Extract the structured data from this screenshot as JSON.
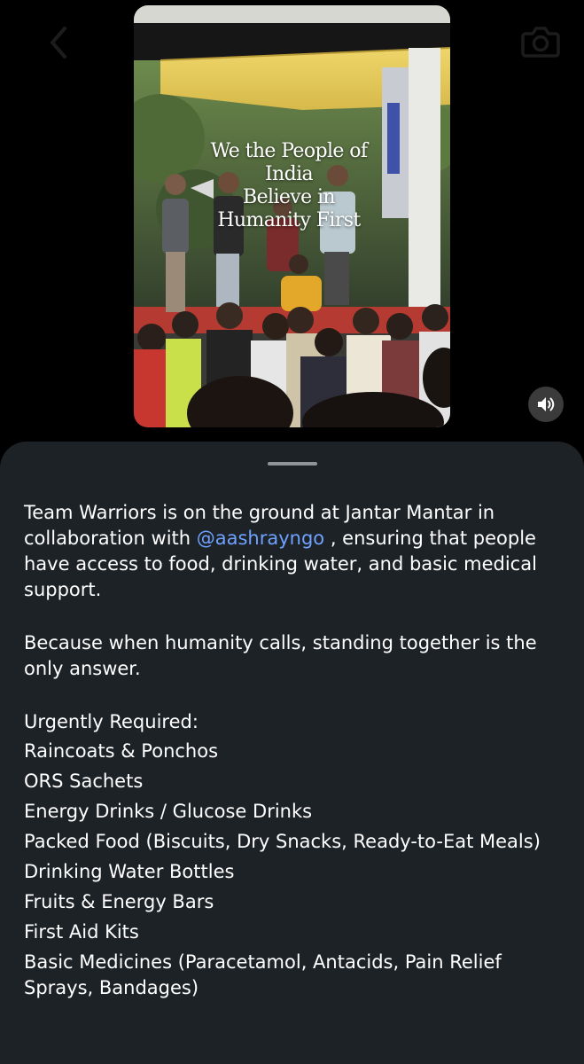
{
  "video": {
    "overlay_text": "We the People of India\nBelieve in\nHumanity First"
  },
  "controls": {
    "back_icon": "chevron-left-icon",
    "camera_icon": "camera-icon",
    "volume_icon": "speaker-on-icon"
  },
  "post": {
    "para1_before": "Team Warriors is on the ground at Jantar Mantar in collaboration with ",
    "mention": "@aashrayngo",
    "para1_after": " , ensuring that people have access to food, drinking water, and basic medical support.",
    "para2": "Because when humanity calls, standing together is the only answer.",
    "required_heading": "Urgently Required:",
    "required_items": [
      "Raincoats & Ponchos",
      "ORS Sachets",
      "Energy Drinks / Glucose Drinks",
      "Packed Food (Biscuits, Dry Snacks, Ready-to-Eat Meals)",
      "Drinking Water Bottles",
      "Fruits & Energy Bars",
      "First Aid Kits",
      "Basic Medicines (Paracetamol, Antacids, Pain Relief Sprays, Bandages)"
    ]
  },
  "colors": {
    "sheet_background": "#1d2227",
    "mention": "#6fa2ff",
    "text": "#ffffff"
  }
}
